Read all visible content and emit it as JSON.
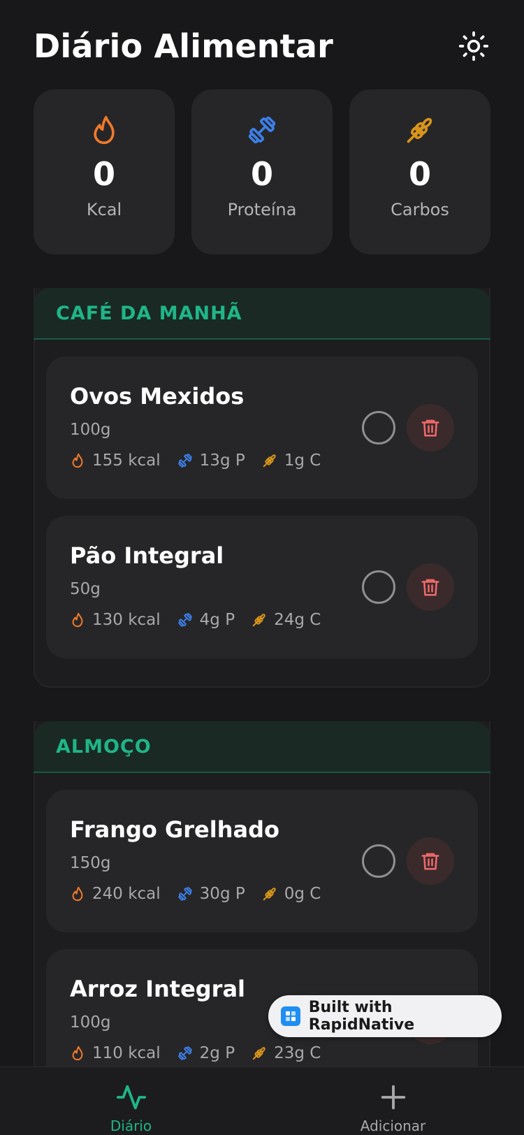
{
  "header": {
    "title": "Diário Alimentar"
  },
  "stats": [
    {
      "value": "0",
      "label": "Kcal",
      "icon": "flame-icon"
    },
    {
      "value": "0",
      "label": "Proteína",
      "icon": "dumbbell-icon"
    },
    {
      "value": "0",
      "label": "Carbos",
      "icon": "wheat-icon"
    }
  ],
  "meals": [
    {
      "title": "CAFÉ DA MANHÃ",
      "items": [
        {
          "name": "Ovos Mexidos",
          "qty": "100g",
          "kcal": "155 kcal",
          "protein": "13g P",
          "carbs": "1g C"
        },
        {
          "name": "Pão Integral",
          "qty": "50g",
          "kcal": "130 kcal",
          "protein": "4g P",
          "carbs": "24g C"
        }
      ]
    },
    {
      "title": "ALMOÇO",
      "items": [
        {
          "name": "Frango Grelhado",
          "qty": "150g",
          "kcal": "240 kcal",
          "protein": "30g P",
          "carbs": "0g C"
        },
        {
          "name": "Arroz Integral",
          "qty": "100g",
          "kcal": "110 kcal",
          "protein": "2g P",
          "carbs": "23g C"
        }
      ]
    }
  ],
  "badge": {
    "text": "Built with RapidNative"
  },
  "tabs": [
    {
      "label": "Diário",
      "icon": "activity-icon"
    },
    {
      "label": "Adicionar",
      "icon": "plus-icon"
    }
  ],
  "colors": {
    "accent": "#1fb587",
    "kcal": "#f07a2a",
    "protein": "#3d7fe8",
    "carbs": "#d9951a",
    "delete": "#f06a6a"
  }
}
